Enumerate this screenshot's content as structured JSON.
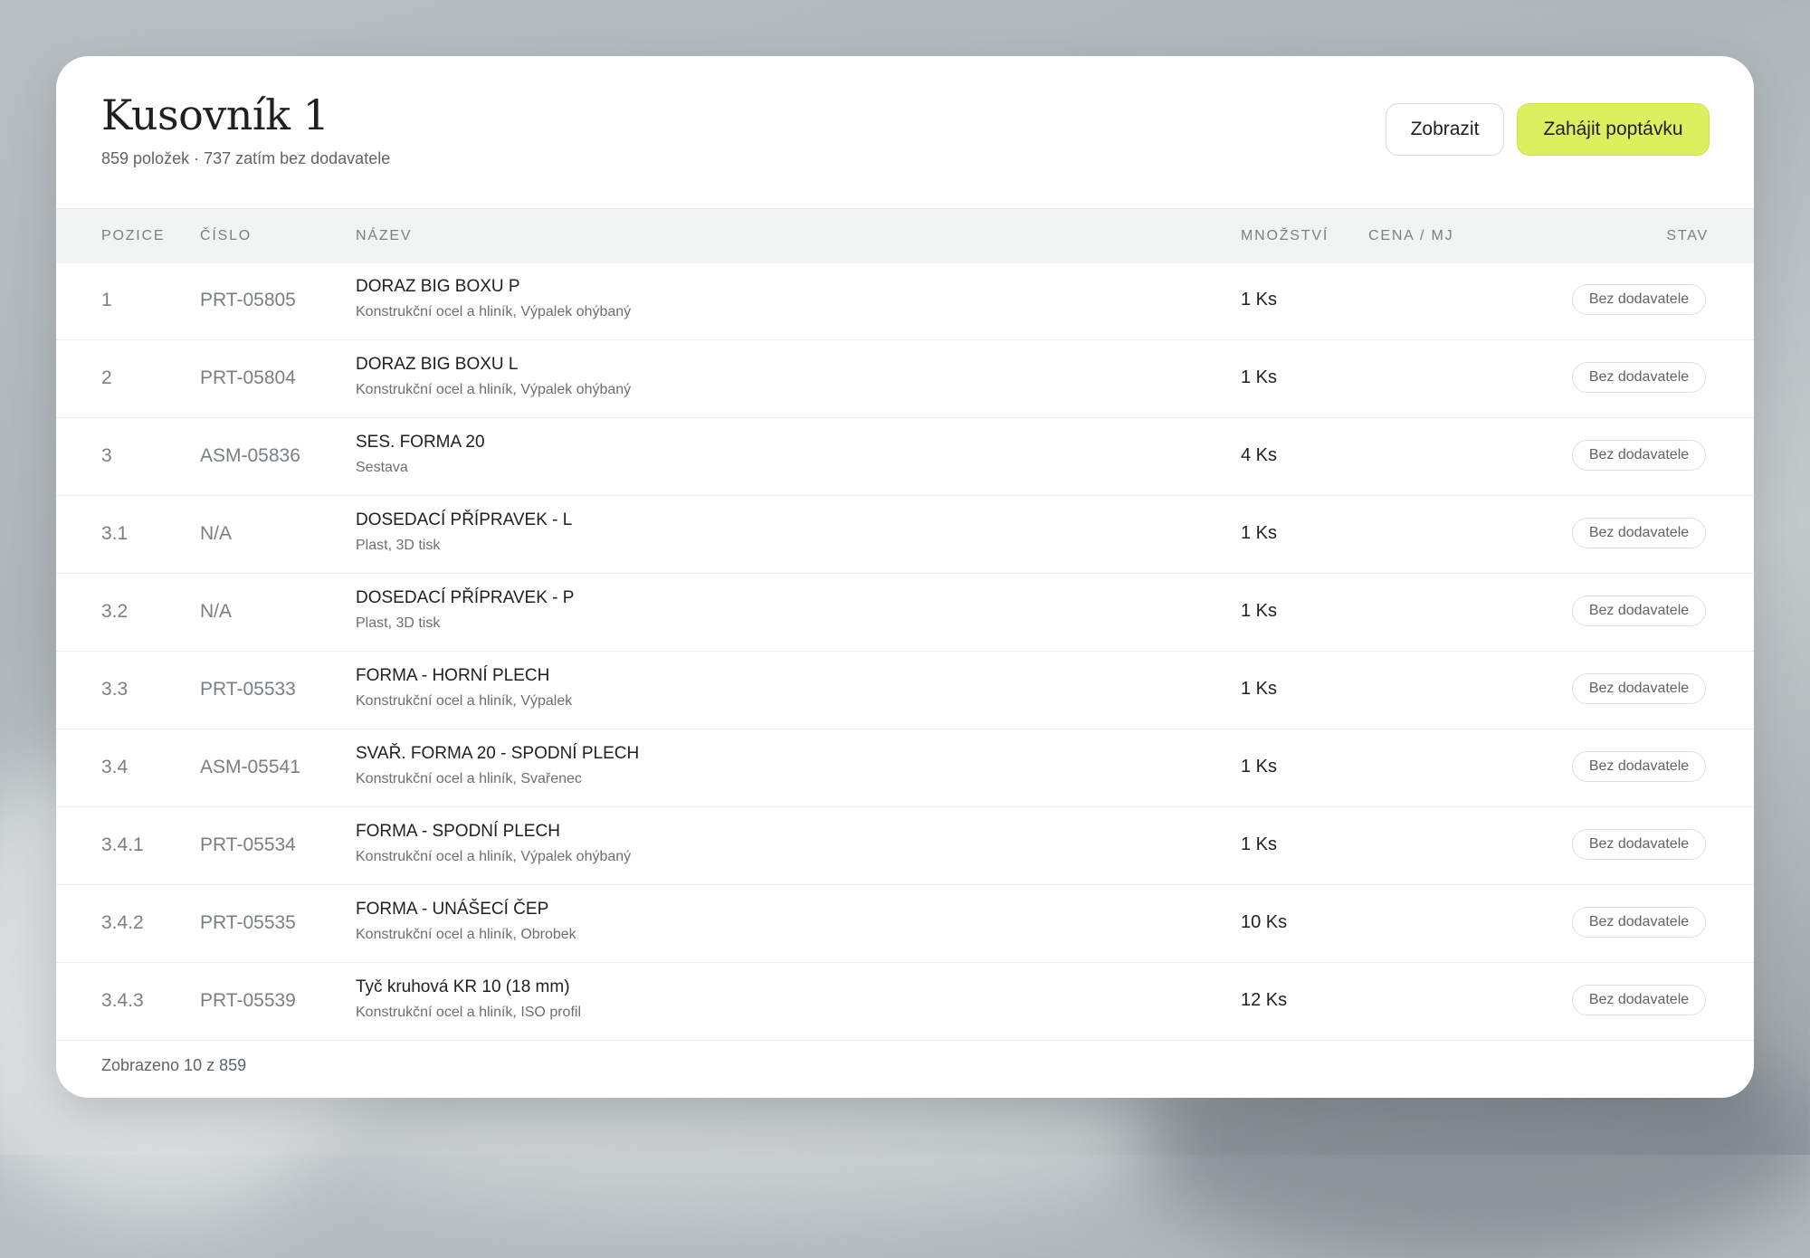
{
  "header": {
    "title": "Kusovník 1",
    "subtitle": "859 položek · 737 zatím bez dodavatele",
    "show_button": "Zobrazit",
    "start_inquiry_button": "Zahájit poptávku"
  },
  "colors": {
    "accent": "#dcef5f",
    "table_header_bg": "#f2f4f4",
    "text_primary": "#1d1f21",
    "text_muted": "#7a7f83"
  },
  "table": {
    "columns": {
      "position": "POZICE",
      "number": "ČÍSLO",
      "name": "NÁZEV",
      "quantity": "MNOŽSTVÍ",
      "price": "CENA / MJ",
      "status": "STAV"
    },
    "rows": [
      {
        "position": "1",
        "number": "PRT-05805",
        "name": "DORAZ BIG BOXU P",
        "description": "Konstrukční ocel a hliník, Výpalek ohýbaný",
        "quantity": "1 Ks",
        "price": "",
        "status": "Bez dodavatele"
      },
      {
        "position": "2",
        "number": "PRT-05804",
        "name": "DORAZ BIG BOXU L",
        "description": "Konstrukční ocel a hliník, Výpalek ohýbaný",
        "quantity": "1 Ks",
        "price": "",
        "status": "Bez dodavatele"
      },
      {
        "position": "3",
        "number": "ASM-05836",
        "name": "SES. FORMA 20",
        "description": "Sestava",
        "quantity": "4 Ks",
        "price": "",
        "status": "Bez dodavatele"
      },
      {
        "position": "3.1",
        "number": "N/A",
        "name": "DOSEDACÍ PŘÍPRAVEK - L",
        "description": "Plast, 3D tisk",
        "quantity": "1 Ks",
        "price": "",
        "status": "Bez dodavatele"
      },
      {
        "position": "3.2",
        "number": "N/A",
        "name": "DOSEDACÍ PŘÍPRAVEK - P",
        "description": "Plast, 3D tisk",
        "quantity": "1 Ks",
        "price": "",
        "status": "Bez dodavatele"
      },
      {
        "position": "3.3",
        "number": "PRT-05533",
        "name": "FORMA - HORNÍ PLECH",
        "description": "Konstrukční ocel a hliník, Výpalek",
        "quantity": "1 Ks",
        "price": "",
        "status": "Bez dodavatele"
      },
      {
        "position": "3.4",
        "number": "ASM-05541",
        "name": "SVAŘ. FORMA 20 - SPODNÍ PLECH",
        "description": "Konstrukční ocel a hliník, Svařenec",
        "quantity": "1 Ks",
        "price": "",
        "status": "Bez dodavatele"
      },
      {
        "position": "3.4.1",
        "number": "PRT-05534",
        "name": "FORMA - SPODNÍ PLECH",
        "description": "Konstrukční ocel a hliník, Výpalek ohýbaný",
        "quantity": "1 Ks",
        "price": "",
        "status": "Bez dodavatele"
      },
      {
        "position": "3.4.2",
        "number": "PRT-05535",
        "name": "FORMA - UNÁŠECÍ ČEP",
        "description": "Konstrukční ocel a hliník, Obrobek",
        "quantity": "10 Ks",
        "price": "",
        "status": "Bez dodavatele"
      },
      {
        "position": "3.4.3",
        "number": "PRT-05539",
        "name": "Tyč kruhová KR 10 (18 mm)",
        "description": "Konstrukční ocel a hliník, ISO profil",
        "quantity": "12 Ks",
        "price": "",
        "status": "Bez dodavatele"
      }
    ]
  },
  "footer": {
    "shown_count": "Zobrazeno 10 z 859"
  }
}
